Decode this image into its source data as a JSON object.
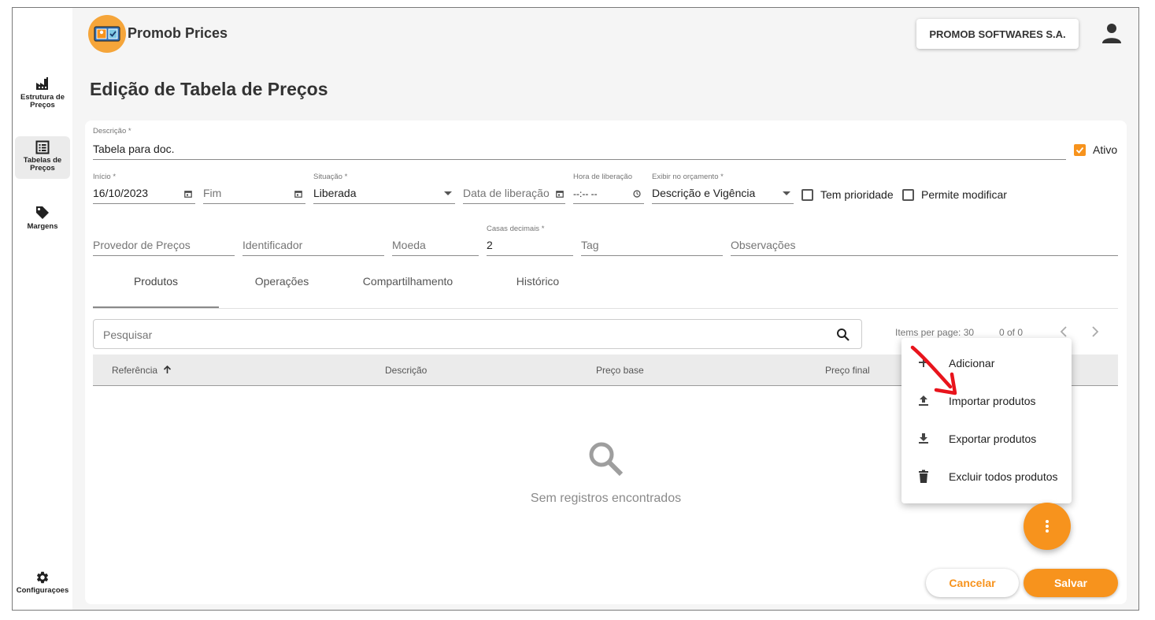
{
  "app": {
    "title": "Promob Prices",
    "company": "PROMOB SOFTWARES S.A."
  },
  "sidebar": {
    "items": [
      {
        "label_line1": "Estrutura de",
        "label_line2": "Preços",
        "icon": "factory-icon"
      },
      {
        "label_line1": "Tabelas de",
        "label_line2": "Preços",
        "icon": "list-icon",
        "active": true
      },
      {
        "label_line1": "Margens",
        "label_line2": "",
        "icon": "tag-icon"
      },
      {
        "label_line1": "Configuraçoes",
        "label_line2": "",
        "icon": "gear-icon"
      }
    ]
  },
  "page": {
    "title": "Edição de Tabela de Preços"
  },
  "form": {
    "descricao": {
      "label": "Descrição *",
      "value": "Tabela para doc."
    },
    "ativo": {
      "label": "Ativo",
      "checked": true
    },
    "inicio": {
      "label": "Início *",
      "value": "16/10/2023"
    },
    "fim": {
      "placeholder": "Fim"
    },
    "situacao": {
      "label": "Situação *",
      "value": "Liberada"
    },
    "data_liberacao": {
      "placeholder": "Data de liberação"
    },
    "hora_liberacao": {
      "label": "Hora de liberação",
      "value": "--:-- --"
    },
    "exibir": {
      "label": "Exibir no orçamento *",
      "value": "Descrição e Vigência"
    },
    "tem_prioridade": {
      "label": "Tem prioridade",
      "checked": false
    },
    "permite_modificar": {
      "label": "Permite modificar",
      "checked": false
    },
    "provedor": {
      "placeholder": "Provedor de Preços"
    },
    "identificador": {
      "placeholder": "Identificador"
    },
    "moeda": {
      "placeholder": "Moeda"
    },
    "casas": {
      "label": "Casas decimais *",
      "value": "2"
    },
    "tag": {
      "placeholder": "Tag"
    },
    "observacoes": {
      "placeholder": "Observações"
    }
  },
  "tabs": [
    {
      "label": "Produtos",
      "active": true
    },
    {
      "label": "Operações"
    },
    {
      "label": "Compartilhamento"
    },
    {
      "label": "Histórico"
    }
  ],
  "search": {
    "placeholder": "Pesquisar"
  },
  "pagination": {
    "items_per_page": "Items per page: 30",
    "range": "0 of 0"
  },
  "table": {
    "columns": [
      "Referência",
      "Descrição",
      "Preço base",
      "Preço final"
    ]
  },
  "empty": {
    "text": "Sem registros encontrados"
  },
  "menu": {
    "items": [
      {
        "label": "Adicionar",
        "icon": "plus-icon"
      },
      {
        "label": "Importar produtos",
        "icon": "upload-icon"
      },
      {
        "label": "Exportar produtos",
        "icon": "download-icon"
      },
      {
        "label": "Excluir todos produtos",
        "icon": "trash-icon"
      }
    ]
  },
  "actions": {
    "cancel": "Cancelar",
    "save": "Salvar"
  },
  "colors": {
    "accent": "#f7931d",
    "annotation_arrow": "#e8141c"
  }
}
